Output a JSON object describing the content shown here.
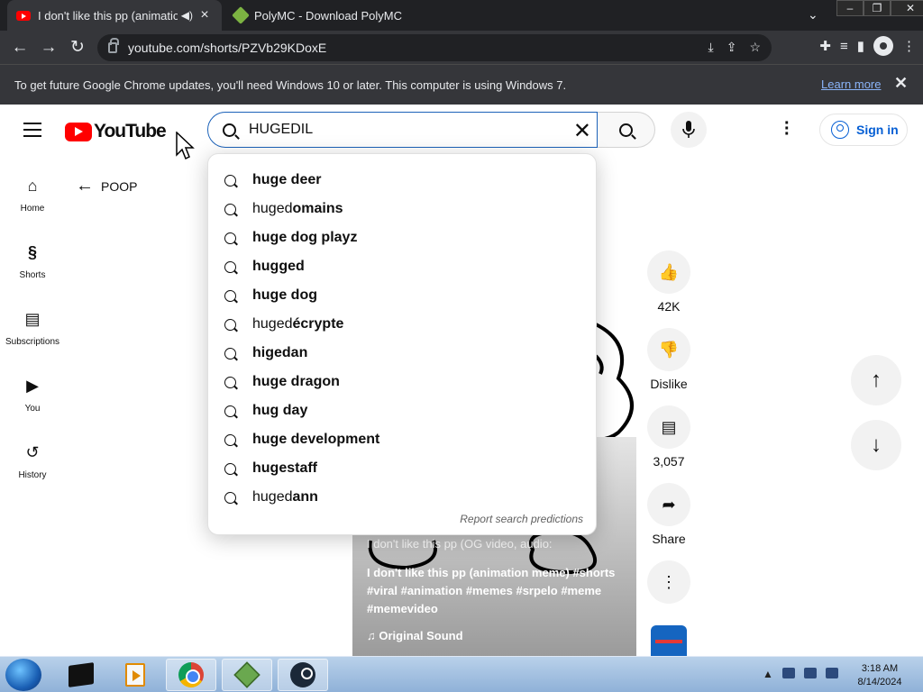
{
  "browser": {
    "tabs": [
      {
        "title": "I don't like this pp (animatio",
        "active": true
      },
      {
        "title": "PolyMC - Download PolyMC",
        "active": false
      }
    ],
    "url": "youtube.com/shorts/PZVb29KDoxE",
    "infobar": {
      "message": "To get future Google Chrome updates, you'll need Windows 10 or later. This computer is using Windows 7.",
      "link": "Learn more"
    }
  },
  "youtube": {
    "logo_text": "YouTube",
    "search": {
      "query": "HUGEDIL"
    },
    "sign_in": "Sign in",
    "guide": [
      {
        "label": "Home",
        "icon": "home-icon"
      },
      {
        "label": "Shorts",
        "icon": "shorts-icon"
      },
      {
        "label": "Subscriptions",
        "icon": "subscriptions-icon"
      },
      {
        "label": "You",
        "icon": "you-icon"
      },
      {
        "label": "History",
        "icon": "history-icon"
      }
    ],
    "back_label": "POOP",
    "suggestions": [
      {
        "pre": "huge deer",
        "bold": true,
        "rest": ""
      },
      {
        "pre": "huged",
        "bold": false,
        "rest": "omains"
      },
      {
        "pre": "huge dog playz",
        "bold": true,
        "rest": ""
      },
      {
        "pre": "hugged",
        "bold": true,
        "rest": ""
      },
      {
        "pre": "huge dog",
        "bold": true,
        "rest": ""
      },
      {
        "pre": "huged",
        "bold": false,
        "rest": "écrypte"
      },
      {
        "pre": "higedan",
        "bold": true,
        "rest": ""
      },
      {
        "pre": "huge dragon",
        "bold": true,
        "rest": ""
      },
      {
        "pre": "hug day",
        "bold": true,
        "rest": ""
      },
      {
        "pre": "huge development",
        "bold": true,
        "rest": ""
      },
      {
        "pre": "hugestaff",
        "bold": true,
        "rest": ""
      },
      {
        "pre": "huged",
        "bold": false,
        "rest": "ann"
      }
    ],
    "report_label": "Report search predictions",
    "short": {
      "audio_line": "I don't like this pp (OG video, audio:",
      "description": "I don't like this pp (animation meme) #shorts #viral #animation #memes #srpelo #meme #memevideo",
      "sound": "Original Sound"
    },
    "actions": {
      "likes": "42K",
      "dislike": "Dislike",
      "comments": "3,057",
      "share": "Share"
    }
  },
  "taskbar": {
    "time": "3:18 AM",
    "date": "8/14/2024"
  }
}
